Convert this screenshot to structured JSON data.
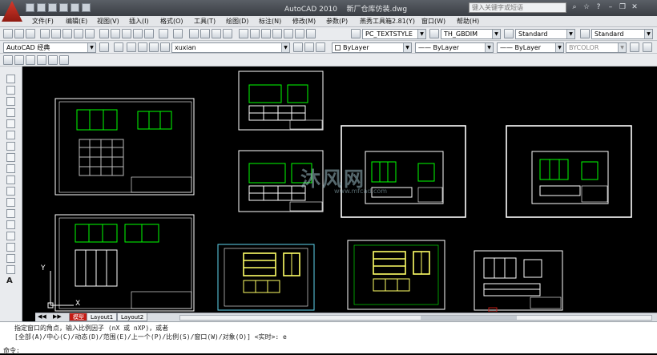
{
  "window": {
    "app_title": "AutoCAD 2010",
    "doc_title": "新厂仓库仿装.dwg",
    "search_placeholder": "键入关键字或短语"
  },
  "menu": [
    "文件(F)",
    "编辑(E)",
    "视图(V)",
    "插入(I)",
    "格式(O)",
    "工具(T)",
    "绘图(D)",
    "标注(N)",
    "修改(M)",
    "参数(P)",
    "燕秀工具箱2.81(Y)",
    "窗口(W)",
    "帮助(H)"
  ],
  "toolbar1": {
    "text_style": "PC_TEXTSTYLE",
    "dim_style": "TH_GBDIM",
    "table_style": "Standard",
    "multileader_style": "Standard"
  },
  "toolbar2": {
    "workspace": "AutoCAD 经典",
    "layer": "xuxian",
    "color": "ByLayer",
    "linetype": "ByLayer",
    "lineweight": "ByLayer",
    "plotstyle": "BYCOLOR"
  },
  "tabs": {
    "model": "模型",
    "layout1": "Layout1",
    "layout2": "Layout2"
  },
  "command": {
    "line1": "指定窗口的角点，输入比例因子 (nX 或 nXP)，或者",
    "line2": "[全部(A)/中心(C)/动态(D)/范围(E)/上一个(P)/比例(S)/窗口(W)/对象(O)] <实时>: e",
    "prompt": "命令:"
  },
  "watermark": {
    "text": "沐风网",
    "url": "www.mfcad.com"
  },
  "ucs": {
    "x": "X",
    "y": "Y"
  },
  "colors": {
    "canvas_bg": "#000000",
    "drawing_white": "#ffffff",
    "drawing_green": "#00ff00",
    "drawing_yellow": "#ffff66",
    "drawing_cyan": "#5fd6f0",
    "accent_red": "#c41b14"
  }
}
